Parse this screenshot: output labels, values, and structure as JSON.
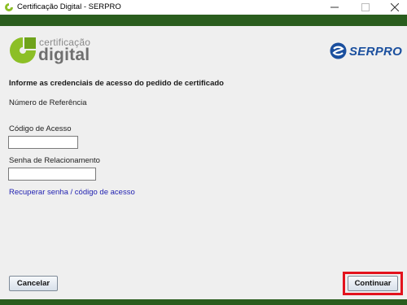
{
  "window": {
    "title": "Certificação Digital - SERPRO",
    "controls": [
      "minimize",
      "maximize",
      "close"
    ]
  },
  "branding": {
    "logo_small_text": "certificação",
    "logo_big_text": "digital",
    "serpro_text": "SERPRO"
  },
  "form": {
    "instructions": "Informe as credenciais de acesso do pedido de certificado",
    "reference_label": "Número de Referência",
    "access_code_label": "Código de Acesso",
    "access_code_value": "",
    "password_label": "Senha de Relacionamento",
    "password_value": "",
    "recover_link": "Recuperar senha / código de acesso"
  },
  "buttons": {
    "cancel": "Cancelar",
    "continue": "Continuar"
  },
  "colors": {
    "green_band": "#2a5d1e",
    "logo_green": "#8cbf26",
    "serpro_blue": "#1a4f9e",
    "highlight": "#e3131d",
    "link": "#1f1fb0"
  }
}
